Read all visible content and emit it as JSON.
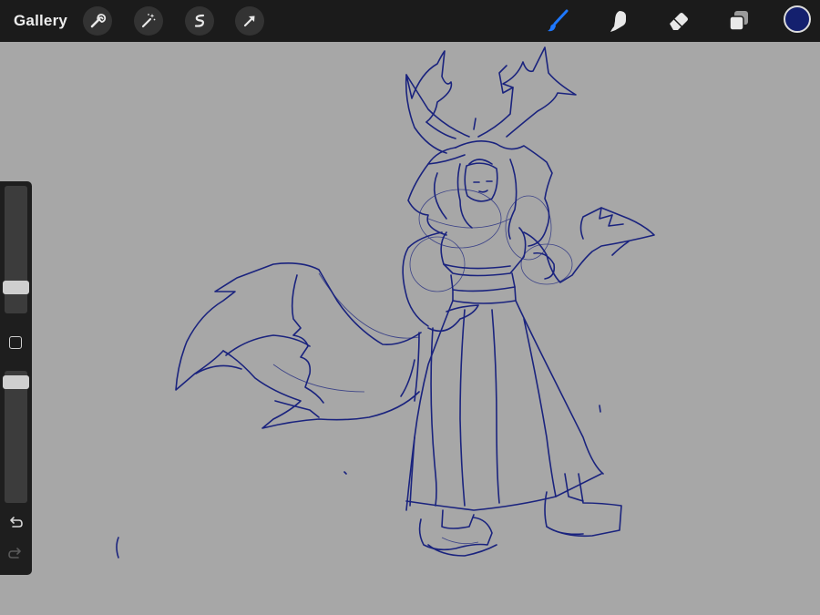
{
  "toolbar": {
    "gallery_label": "Gallery",
    "left_tools": [
      {
        "name": "actions",
        "icon": "wrench-icon"
      },
      {
        "name": "adjustments",
        "icon": "magic-wand-icon"
      },
      {
        "name": "selection",
        "icon": "selection-s-icon"
      },
      {
        "name": "transform",
        "icon": "arrow-cursor-icon"
      }
    ],
    "right_tools": [
      {
        "name": "brush",
        "icon": "brush-icon",
        "active": true,
        "active_color": "#1e78ff"
      },
      {
        "name": "smudge",
        "icon": "smudge-finger-icon"
      },
      {
        "name": "eraser",
        "icon": "eraser-icon"
      },
      {
        "name": "layers",
        "icon": "layers-icon"
      }
    ],
    "current_color": "#14206e"
  },
  "sidebar": {
    "brush_size_level": 0.22,
    "opacity_level": 0.95,
    "modify_button_icon": "square-icon",
    "undo_icon": "undo-icon",
    "redo_icon": "redo-icon",
    "redo_enabled": false
  },
  "canvas": {
    "background_color": "#a7a7a7",
    "stroke_color": "#1a237e",
    "content": "sketch"
  }
}
